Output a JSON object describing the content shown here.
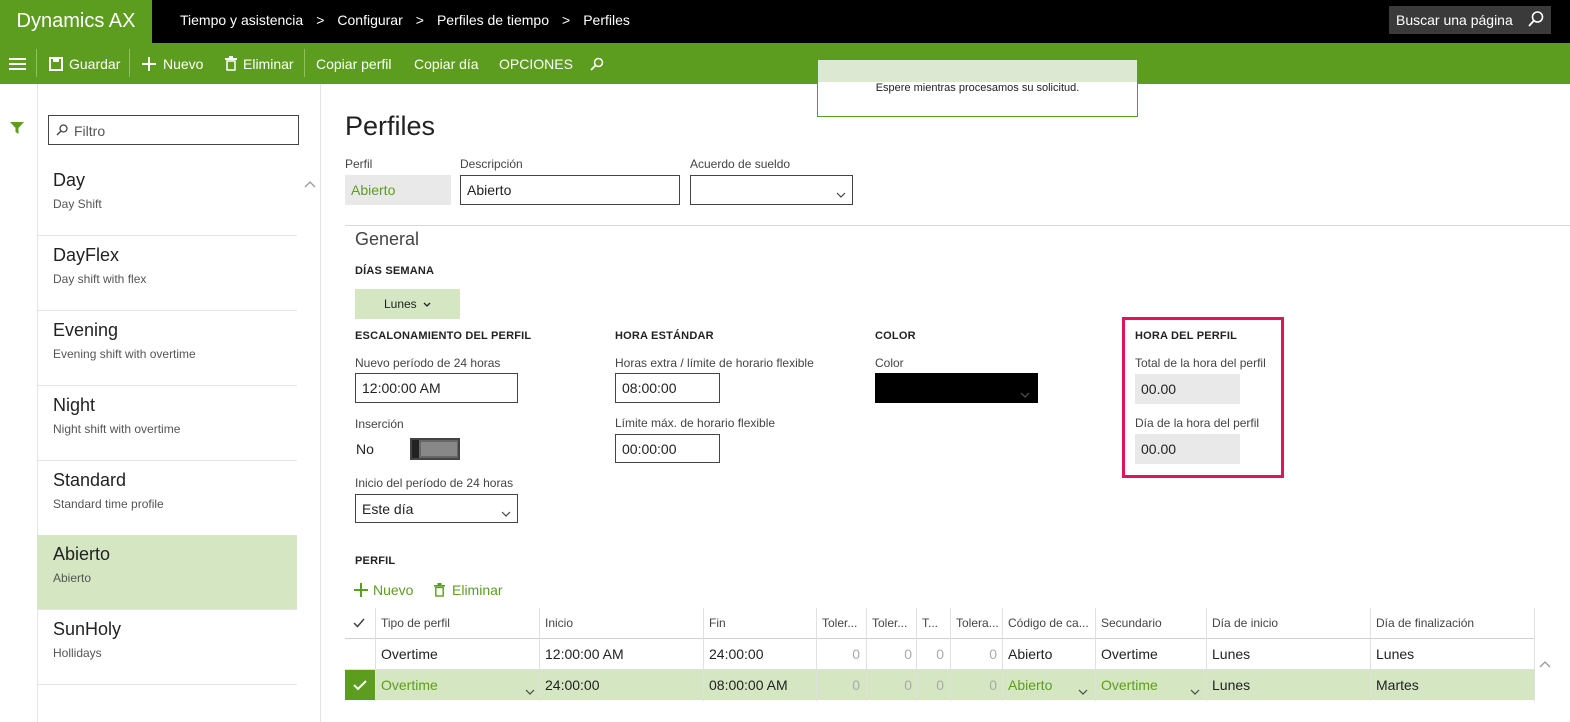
{
  "app": {
    "brand": "Dynamics AX"
  },
  "breadcrumb": [
    "Tiempo y asistencia",
    "Configurar",
    "Perfiles de tiempo",
    "Perfiles"
  ],
  "search": {
    "placeholder": "Buscar una página"
  },
  "actions": {
    "save": "Guardar",
    "new": "Nuevo",
    "delete": "Eliminar",
    "copy_profile": "Copiar perfil",
    "copy_day": "Copiar día",
    "options": "OPCIONES"
  },
  "toast": {
    "message": "Espere mientras procesamos su solicitud."
  },
  "list": {
    "filter_placeholder": "Filtro",
    "items": [
      {
        "title": "Day",
        "subtitle": "Day Shift"
      },
      {
        "title": "DayFlex",
        "subtitle": "Day shift with flex"
      },
      {
        "title": "Evening",
        "subtitle": "Evening shift with overtime"
      },
      {
        "title": "Night",
        "subtitle": "Night shift with overtime"
      },
      {
        "title": "Standard",
        "subtitle": "Standard time profile"
      },
      {
        "title": "Abierto",
        "subtitle": "Abierto",
        "selected": true
      },
      {
        "title": "SunHoly",
        "subtitle": "Hollidays"
      }
    ]
  },
  "page": {
    "title": "Perfiles",
    "profile_label": "Perfil",
    "profile_value": "Abierto",
    "description_label": "Descripción",
    "description_value": "Abierto",
    "wage_label": "Acuerdo de sueldo",
    "wage_value": ""
  },
  "general": {
    "title": "General",
    "weekdays_heading": "DÍAS SEMANA",
    "weekday_button": "Lunes",
    "staggering": {
      "heading": "ESCALONAMIENTO DEL PERFIL",
      "new_period_label": "Nuevo período de 24 horas",
      "new_period_value": "12:00:00 AM",
      "insert_label": "Inserción",
      "insert_value": "No",
      "start_label": "Inicio del período de 24 horas",
      "start_value": "Este día"
    },
    "standard_hour": {
      "heading": "HORA ESTÁNDAR",
      "overtime_label": "Horas extra / límite de horario flexible",
      "overtime_value": "08:00:00",
      "max_label": "Límite máx. de horario flexible",
      "max_value": "00:00:00"
    },
    "color": {
      "heading": "COLOR",
      "label": "Color",
      "value": "#000000"
    },
    "profile_hour": {
      "heading": "HORA DEL PERFIL",
      "total_label": "Total de la hora del perfil",
      "total_value": "00.00",
      "day_label": "Día de la hora del perfil",
      "day_value": "00.00"
    }
  },
  "profile_grid": {
    "heading": "PERFIL",
    "new": "Nuevo",
    "delete": "Eliminar",
    "columns": [
      "Tipo de perfil",
      "Inicio",
      "Fin",
      "Toler...",
      "Toler...",
      "T...",
      "Tolera...",
      "Código de ca...",
      "Secundario",
      "Día de inicio",
      "Día de finalización"
    ],
    "rows": [
      [
        "Overtime",
        "12:00:00 AM",
        "24:00:00",
        "0",
        "0",
        "0",
        "0",
        "Abierto",
        "Overtime",
        "Lunes",
        "Lunes"
      ],
      [
        "Overtime",
        "24:00:00",
        "08:00:00 AM",
        "0",
        "0",
        "0",
        "0",
        "Abierto",
        "Overtime",
        "Lunes",
        "Martes"
      ]
    ]
  },
  "colors": {
    "accent": "#5c9d1f",
    "selected": "#d5e6c3",
    "highlight_border": "#e0145a"
  }
}
